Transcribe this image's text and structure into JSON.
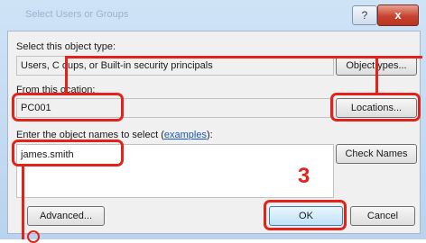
{
  "dialog": {
    "title": "Select Users or Groups",
    "help_label": "?",
    "close_label": "x"
  },
  "object_type": {
    "label": "Select this object type:",
    "value": "Users, C  oups, or Built-in security principals",
    "button": "Object  ypes..."
  },
  "location": {
    "label": "From this  ocation:",
    "value": "PC001",
    "button": "Locations..."
  },
  "names": {
    "label_prefix": "Enter the object names to select (",
    "link": "examples",
    "label_suffix": "):",
    "value": "james.smith",
    "check_button": "Check Names"
  },
  "buttons": {
    "advanced": "Advanced...",
    "ok": "OK",
    "cancel": "Cancel"
  },
  "annotation": {
    "step": "3",
    "color": "#e2231a"
  }
}
